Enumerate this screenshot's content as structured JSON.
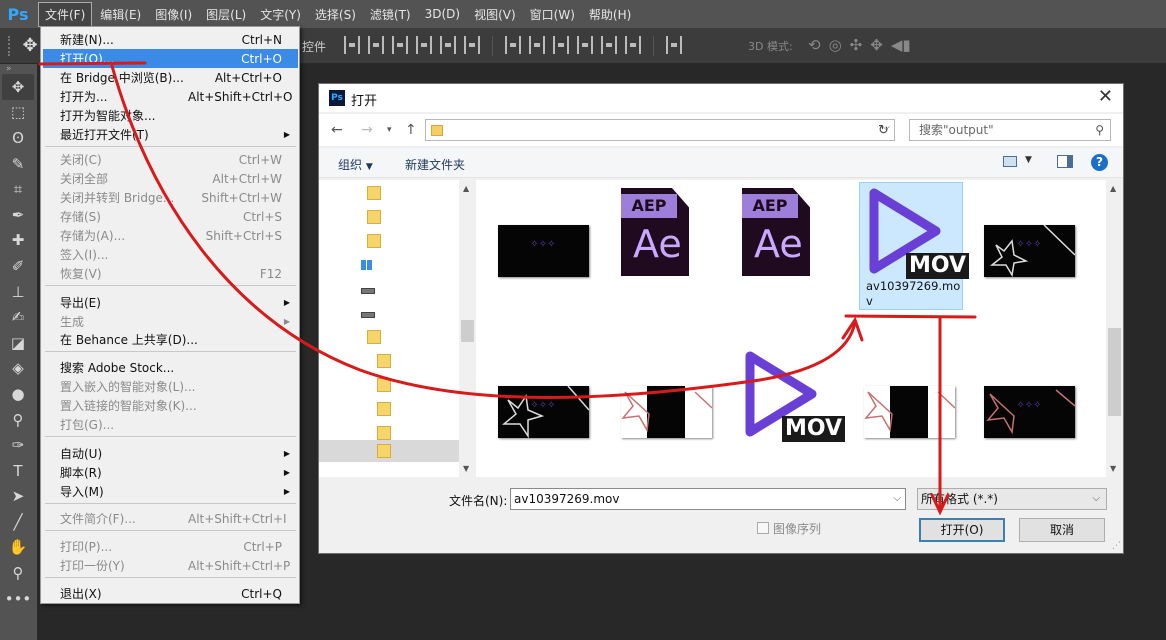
{
  "app": {
    "logo": "Ps",
    "menus": [
      "文件(F)",
      "编辑(E)",
      "图像(I)",
      "图层(L)",
      "文字(Y)",
      "选择(S)",
      "滤镜(T)",
      "3D(D)",
      "视图(V)",
      "窗口(W)",
      "帮助(H)"
    ],
    "active_menu": "文件(F)"
  },
  "options_bar": {
    "partial_text": "控件",
    "mode_3d_label": "3D 模式:"
  },
  "file_menu": {
    "items": [
      {
        "label": "新建(N)...",
        "shortcut": "Ctrl+N"
      },
      {
        "label": "打开(O)...",
        "shortcut": "Ctrl+O"
      },
      {
        "label": "在 Bridge 中浏览(B)...",
        "shortcut": "Alt+Ctrl+O"
      },
      {
        "label": "打开为...",
        "shortcut": "Alt+Shift+Ctrl+O"
      },
      {
        "label": "打开为智能对象...",
        "shortcut": ""
      },
      {
        "label": "最近打开文件(T)",
        "shortcut": ""
      },
      {
        "label": "关闭(C)",
        "shortcut": "Ctrl+W"
      },
      {
        "label": "关闭全部",
        "shortcut": "Alt+Ctrl+W"
      },
      {
        "label": "关闭并转到 Bridge...",
        "shortcut": "Shift+Ctrl+W"
      },
      {
        "label": "存储(S)",
        "shortcut": "Ctrl+S"
      },
      {
        "label": "存储为(A)...",
        "shortcut": "Shift+Ctrl+S"
      },
      {
        "label": "签入(I)...",
        "shortcut": ""
      },
      {
        "label": "恢复(V)",
        "shortcut": "F12"
      },
      {
        "label": "导出(E)",
        "shortcut": ""
      },
      {
        "label": "生成",
        "shortcut": ""
      },
      {
        "label": "在 Behance 上共享(D)...",
        "shortcut": ""
      },
      {
        "label": "搜索 Adobe Stock...",
        "shortcut": ""
      },
      {
        "label": "置入嵌入的智能对象(L)...",
        "shortcut": ""
      },
      {
        "label": "置入链接的智能对象(K)...",
        "shortcut": ""
      },
      {
        "label": "打包(G)...",
        "shortcut": ""
      },
      {
        "label": "自动(U)",
        "shortcut": ""
      },
      {
        "label": "脚本(R)",
        "shortcut": ""
      },
      {
        "label": "导入(M)",
        "shortcut": ""
      },
      {
        "label": "文件简介(F)...",
        "shortcut": "Alt+Shift+Ctrl+I"
      },
      {
        "label": "打印(P)...",
        "shortcut": "Ctrl+P"
      },
      {
        "label": "打印一份(Y)",
        "shortcut": "Alt+Shift+Ctrl+P"
      },
      {
        "label": "退出(X)",
        "shortcut": "Ctrl+Q"
      }
    ]
  },
  "dialog": {
    "title": "打开",
    "search_placeholder": "搜索\"output\"",
    "organize": "组织",
    "new_folder": "新建文件夹",
    "files": [
      {
        "label": "",
        "kind": "video-thumb-black"
      },
      {
        "label": "",
        "kind": "aep",
        "badge": "AEP",
        "letters": "Ae"
      },
      {
        "label": "",
        "kind": "aep",
        "badge": "AEP",
        "letters": "Ae"
      },
      {
        "label": "av10397269.mov",
        "kind": "mov",
        "badge": "MOV"
      },
      {
        "label": "",
        "kind": "video-thumb-stars"
      },
      {
        "label": "",
        "kind": "video-thumb-stars"
      },
      {
        "label": "",
        "kind": "video-thumb-white"
      },
      {
        "label": "",
        "kind": "mov",
        "badge": "MOV"
      },
      {
        "label": "",
        "kind": "video-thumb-white"
      },
      {
        "label": "",
        "kind": "video-thumb-stars"
      }
    ],
    "filename_label": "文件名(N):",
    "filename_value": "av10397269.mov",
    "filetype_value": "所有格式 (*.*)",
    "sequence_label": "图像序列",
    "open_button": "打开(O)",
    "cancel_button": "取消"
  },
  "colors": {
    "menu_highlight": "#3b8ae6",
    "annotation_red": "#d91a1a",
    "mov_purple": "#6a3fd6",
    "ae_purple": "#9d7ed9"
  }
}
